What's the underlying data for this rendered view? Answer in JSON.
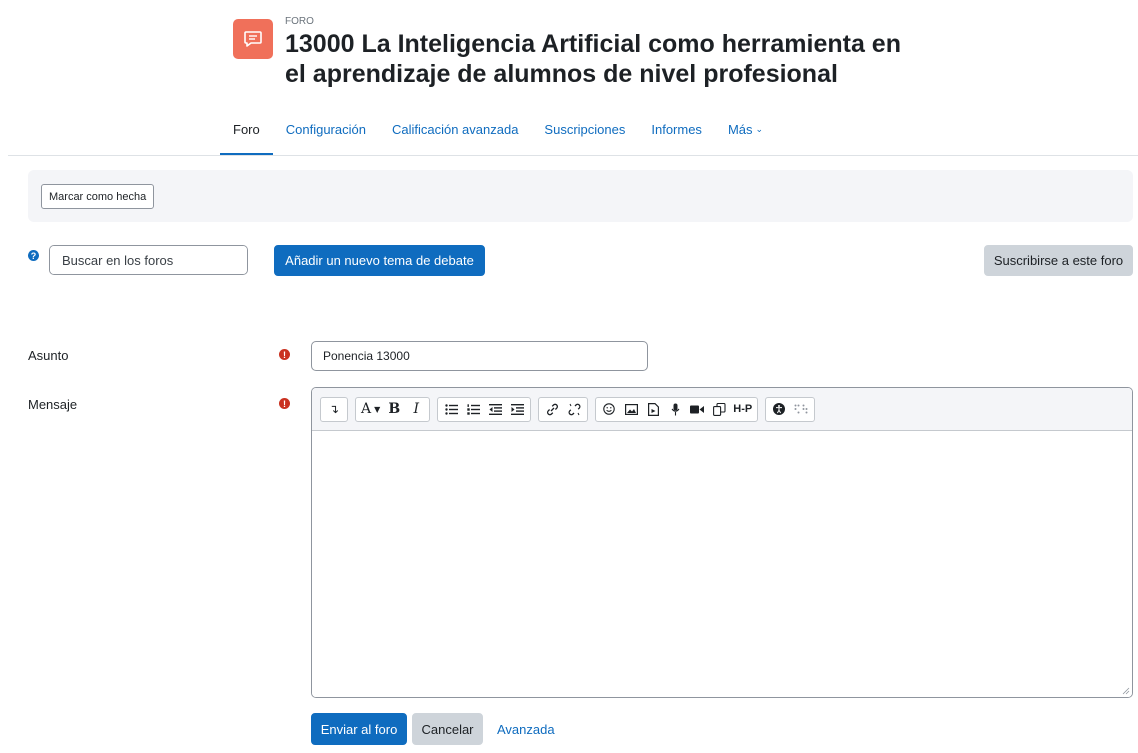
{
  "header": {
    "activity_type": "FORO",
    "title": "13000 La Inteligencia Artificial como herramienta en el aprendizaje de alumnos de nivel profesional",
    "icon": "forum-icon",
    "icon_color": "#f0705a"
  },
  "nav": {
    "tabs": [
      {
        "label": "Foro",
        "active": true
      },
      {
        "label": "Configuración"
      },
      {
        "label": "Calificación avanzada"
      },
      {
        "label": "Suscripciones"
      },
      {
        "label": "Informes"
      },
      {
        "label": "Más"
      }
    ]
  },
  "completion": {
    "mark_done_label": "Marcar como hecha"
  },
  "actions": {
    "search_placeholder": "Buscar en los foros",
    "add_topic_label": "Añadir un nuevo tema de debate",
    "subscribe_label": "Suscribirse a este foro"
  },
  "form": {
    "subject_label": "Asunto",
    "subject_value": "Ponencia 13000",
    "message_label": "Mensaje",
    "message_value": "",
    "submit_label": "Enviar al foro",
    "cancel_label": "Cancelar",
    "advanced_label": "Avanzada"
  },
  "colors": {
    "primary": "#0f6cbf",
    "required": "#ca3120",
    "secondary_button": "#ced4da"
  }
}
